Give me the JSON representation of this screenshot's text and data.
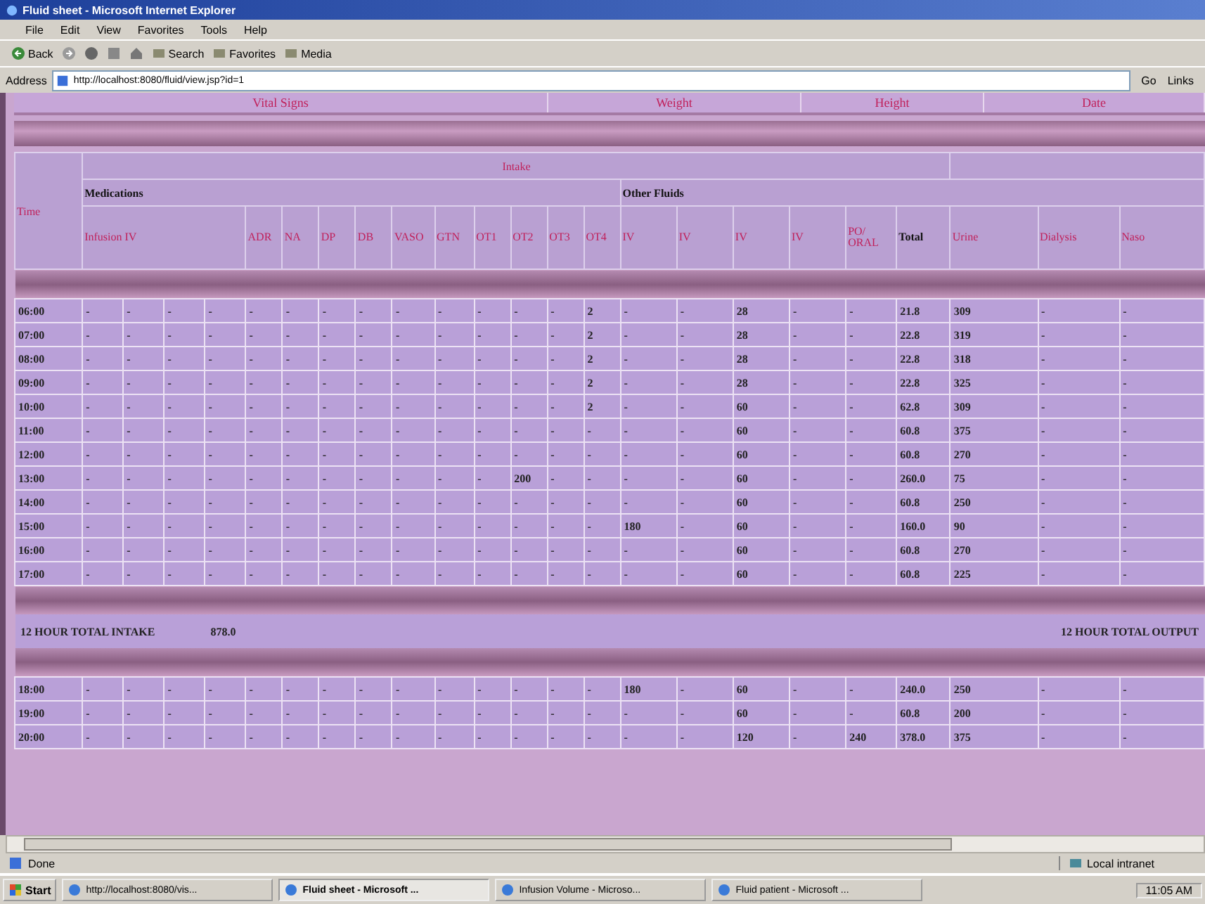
{
  "window": {
    "title": "Fluid sheet - Microsoft Internet Explorer"
  },
  "menu": [
    "File",
    "Edit",
    "View",
    "Favorites",
    "Tools",
    "Help"
  ],
  "toolbar": {
    "back": "Back",
    "buttons": [
      "Search",
      "Favorites",
      "Media"
    ]
  },
  "address": {
    "label": "Address",
    "value": "http://localhost:8080/fluid/view.jsp?id=1",
    "go": "Go",
    "links": "Links"
  },
  "top_header": [
    "Vital Signs",
    "Weight",
    "Height",
    "Date"
  ],
  "chart_header": {
    "time": "Time",
    "intake": "Intake",
    "medications": "Medications",
    "other_fluids": "Other Fluids",
    "columns": [
      {
        "label": "Infusion IV",
        "kind": "group"
      },
      {
        "label": "ADR",
        "kind": "label"
      },
      {
        "label": "NA",
        "kind": "label"
      },
      {
        "label": "DP",
        "kind": "label"
      },
      {
        "label": "DB",
        "kind": "label"
      },
      {
        "label": "VASO",
        "kind": "label"
      },
      {
        "label": "GTN",
        "kind": "label"
      },
      {
        "label": "OT1",
        "kind": "label"
      },
      {
        "label": "OT2",
        "kind": "label"
      },
      {
        "label": "OT3",
        "kind": "label"
      },
      {
        "label": "OT4",
        "kind": "label"
      },
      {
        "label": "IV",
        "kind": "label"
      },
      {
        "label": "IV",
        "kind": "label"
      },
      {
        "label": "IV",
        "kind": "label"
      },
      {
        "label": "IV",
        "kind": "label"
      },
      {
        "label": "PO/ ORAL",
        "kind": "label"
      },
      {
        "label": "Total",
        "kind": "total"
      },
      {
        "label": "Urine",
        "kind": "label"
      },
      {
        "label": "Dialysis",
        "kind": "label"
      },
      {
        "label": "Naso",
        "kind": "label"
      }
    ]
  },
  "rows_day": [
    {
      "time": "06:00",
      "cells": [
        "-",
        "-",
        "-",
        "-",
        "-",
        "-",
        "-",
        "-",
        "-",
        "-",
        "-",
        "-",
        "-",
        "2",
        "-",
        "-",
        "28",
        "-",
        "-",
        "21.8",
        "309",
        "-",
        "-"
      ]
    },
    {
      "time": "07:00",
      "cells": [
        "-",
        "-",
        "-",
        "-",
        "-",
        "-",
        "-",
        "-",
        "-",
        "-",
        "-",
        "-",
        "-",
        "2",
        "-",
        "-",
        "28",
        "-",
        "-",
        "22.8",
        "319",
        "-",
        "-"
      ]
    },
    {
      "time": "08:00",
      "cells": [
        "-",
        "-",
        "-",
        "-",
        "-",
        "-",
        "-",
        "-",
        "-",
        "-",
        "-",
        "-",
        "-",
        "2",
        "-",
        "-",
        "28",
        "-",
        "-",
        "22.8",
        "318",
        "-",
        "-"
      ]
    },
    {
      "time": "09:00",
      "cells": [
        "-",
        "-",
        "-",
        "-",
        "-",
        "-",
        "-",
        "-",
        "-",
        "-",
        "-",
        "-",
        "-",
        "2",
        "-",
        "-",
        "28",
        "-",
        "-",
        "22.8",
        "325",
        "-",
        "-"
      ]
    },
    {
      "time": "10:00",
      "cells": [
        "-",
        "-",
        "-",
        "-",
        "-",
        "-",
        "-",
        "-",
        "-",
        "-",
        "-",
        "-",
        "-",
        "2",
        "-",
        "-",
        "60",
        "-",
        "-",
        "62.8",
        "309",
        "-",
        "-"
      ]
    },
    {
      "time": "11:00",
      "cells": [
        "-",
        "-",
        "-",
        "-",
        "-",
        "-",
        "-",
        "-",
        "-",
        "-",
        "-",
        "-",
        "-",
        "-",
        "-",
        "-",
        "60",
        "-",
        "-",
        "60.8",
        "375",
        "-",
        "-"
      ]
    },
    {
      "time": "12:00",
      "cells": [
        "-",
        "-",
        "-",
        "-",
        "-",
        "-",
        "-",
        "-",
        "-",
        "-",
        "-",
        "-",
        "-",
        "-",
        "-",
        "-",
        "60",
        "-",
        "-",
        "60.8",
        "270",
        "-",
        "-"
      ]
    },
    {
      "time": "13:00",
      "cells": [
        "-",
        "-",
        "-",
        "-",
        "-",
        "-",
        "-",
        "-",
        "-",
        "-",
        "-",
        "200",
        "-",
        "-",
        "-",
        "-",
        "60",
        "-",
        "-",
        "260.0",
        "75",
        "-",
        "-"
      ]
    },
    {
      "time": "14:00",
      "cells": [
        "-",
        "-",
        "-",
        "-",
        "-",
        "-",
        "-",
        "-",
        "-",
        "-",
        "-",
        "-",
        "-",
        "-",
        "-",
        "-",
        "60",
        "-",
        "-",
        "60.8",
        "250",
        "-",
        "-"
      ]
    },
    {
      "time": "15:00",
      "cells": [
        "-",
        "-",
        "-",
        "-",
        "-",
        "-",
        "-",
        "-",
        "-",
        "-",
        "-",
        "-",
        "-",
        "-",
        "180",
        "-",
        "60",
        "-",
        "-",
        "160.0",
        "90",
        "-",
        "-"
      ]
    },
    {
      "time": "16:00",
      "cells": [
        "-",
        "-",
        "-",
        "-",
        "-",
        "-",
        "-",
        "-",
        "-",
        "-",
        "-",
        "-",
        "-",
        "-",
        "-",
        "-",
        "60",
        "-",
        "-",
        "60.8",
        "270",
        "-",
        "-"
      ]
    },
    {
      "time": "17:00",
      "cells": [
        "-",
        "-",
        "-",
        "-",
        "-",
        "-",
        "-",
        "-",
        "-",
        "-",
        "-",
        "-",
        "-",
        "-",
        "-",
        "-",
        "60",
        "-",
        "-",
        "60.8",
        "225",
        "-",
        "-"
      ]
    }
  ],
  "summary": {
    "intake_label": "12 HOUR TOTAL INTAKE",
    "intake_value": "878.0",
    "output_label": "12 HOUR TOTAL OUTPUT"
  },
  "rows_night": [
    {
      "time": "18:00",
      "cells": [
        "-",
        "-",
        "-",
        "-",
        "-",
        "-",
        "-",
        "-",
        "-",
        "-",
        "-",
        "-",
        "-",
        "-",
        "180",
        "-",
        "60",
        "-",
        "-",
        "240.0",
        "250",
        "-",
        "-"
      ]
    },
    {
      "time": "19:00",
      "cells": [
        "-",
        "-",
        "-",
        "-",
        "-",
        "-",
        "-",
        "-",
        "-",
        "-",
        "-",
        "-",
        "-",
        "-",
        "-",
        "-",
        "60",
        "-",
        "-",
        "60.8",
        "200",
        "-",
        "-"
      ]
    },
    {
      "time": "20:00",
      "cells": [
        "-",
        "-",
        "-",
        "-",
        "-",
        "-",
        "-",
        "-",
        "-",
        "-",
        "-",
        "-",
        "-",
        "-",
        "-",
        "-",
        "120",
        "-",
        "240",
        "378.0",
        "375",
        "-",
        "-"
      ]
    }
  ],
  "status": {
    "text": "Done",
    "zone": "Local intranet"
  },
  "taskbar": {
    "start": "Start",
    "items": [
      {
        "label": "http://localhost:8080/vis...",
        "selected": false
      },
      {
        "label": "Fluid sheet - Microsoft ...",
        "selected": true
      },
      {
        "label": "Infusion Volume - Microso...",
        "selected": false
      },
      {
        "label": "Fluid patient - Microsoft ...",
        "selected": false
      }
    ],
    "clock": "11:05 AM"
  }
}
